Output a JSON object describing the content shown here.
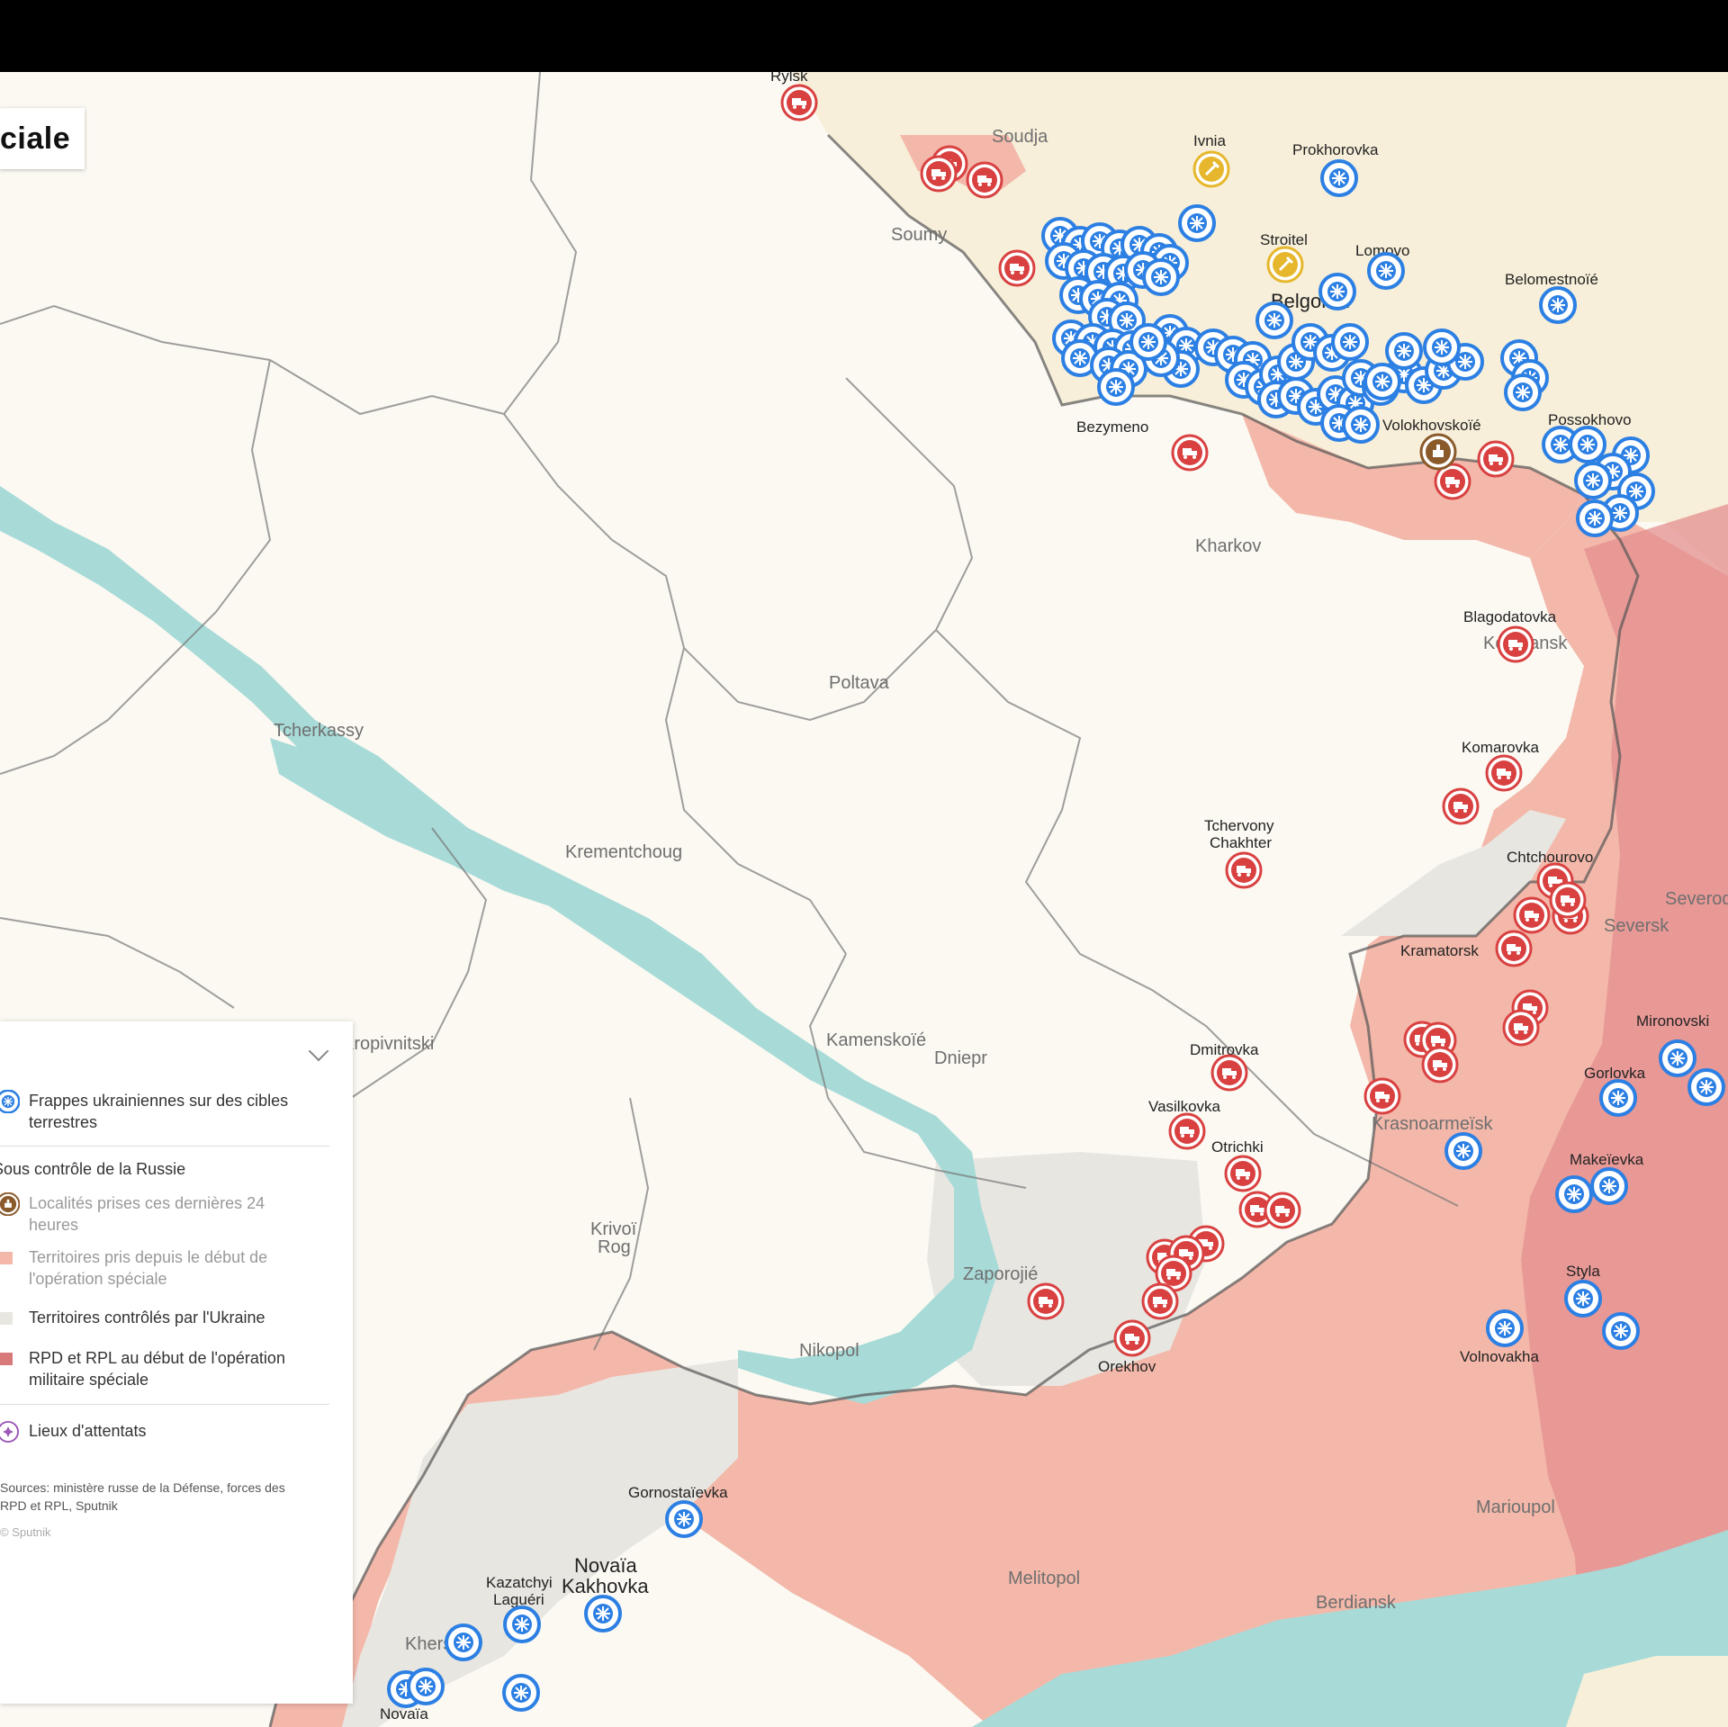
{
  "title": "ciale",
  "map": {
    "cities_major": [
      {
        "id": "soumy",
        "name": "Soumy"
      },
      {
        "id": "kharkov",
        "name": "Kharkov"
      },
      {
        "id": "poltava",
        "name": "Poltava"
      },
      {
        "id": "tcherkassy",
        "name": "Tcherkassy"
      },
      {
        "id": "krementchoug",
        "name": "Krementchoug"
      },
      {
        "id": "kamenskoie",
        "name": "Kamenskoïé"
      },
      {
        "id": "dniepr",
        "name": "Dniepr"
      },
      {
        "id": "krivoi",
        "name": "Krivoï"
      },
      {
        "id": "rog",
        "name": "Rog"
      },
      {
        "id": "zaporojie",
        "name": "Zaporojié"
      },
      {
        "id": "nikopol",
        "name": "Nikopol"
      },
      {
        "id": "melitopol",
        "name": "Melitopol"
      },
      {
        "id": "berdiansk",
        "name": "Berdiansk"
      },
      {
        "id": "marioupol",
        "name": "Marioupol"
      },
      {
        "id": "krasnoarmeisk",
        "name": "Krasnoarmeïsk"
      },
      {
        "id": "seversk",
        "name": "Seversk"
      },
      {
        "id": "soudja",
        "name": "Soudja"
      },
      {
        "id": "kherson",
        "name": "Kherson"
      },
      {
        "id": "kirovograd",
        "name": "Kropivnitski"
      },
      {
        "id": "koupiansk",
        "name": "Koupiansk"
      },
      {
        "id": "severodonetsk",
        "name": "Severodonetsk"
      }
    ],
    "towns": [
      {
        "id": "rylsk",
        "name": "Rylsk"
      },
      {
        "id": "ivnia",
        "name": "Ivnia"
      },
      {
        "id": "prokhorovka",
        "name": "Prokhorovka"
      },
      {
        "id": "stroitel",
        "name": "Stroitel"
      },
      {
        "id": "lomovo",
        "name": "Lomovo"
      },
      {
        "id": "belomestnoie",
        "name": "Belomestnoïé"
      },
      {
        "id": "belgorod",
        "name": "Belgorod"
      },
      {
        "id": "bezymeno",
        "name": "Bezymeno"
      },
      {
        "id": "volokhovskoie",
        "name": "Volokhovskoïé"
      },
      {
        "id": "possokhovo",
        "name": "Possokhovo"
      },
      {
        "id": "blagodatovka",
        "name": "Blagodatovka"
      },
      {
        "id": "komarovka",
        "name": "Komarovka"
      },
      {
        "id": "tchervony1",
        "name": "Tchervony"
      },
      {
        "id": "tchervony2",
        "name": "Chakhter"
      },
      {
        "id": "tchtchourovo",
        "name": "Chtchourovo"
      },
      {
        "id": "kramatorsk",
        "name": "Kramatorsk"
      },
      {
        "id": "mironovski",
        "name": "Mironovski"
      },
      {
        "id": "gorlovka",
        "name": "Gorlovka"
      },
      {
        "id": "dmitrovka",
        "name": "Dmitrovka"
      },
      {
        "id": "vasilkovka",
        "name": "Vasilkovka"
      },
      {
        "id": "otrichki",
        "name": "Otrichki"
      },
      {
        "id": "makeievka",
        "name": "Makeïevka"
      },
      {
        "id": "styla",
        "name": "Styla"
      },
      {
        "id": "volnovakha",
        "name": "Volnovakha"
      },
      {
        "id": "orekhov",
        "name": "Orekhov"
      },
      {
        "id": "gornostaievka",
        "name": "Gornostaïevka"
      },
      {
        "id": "kazatchyi1",
        "name": "Kazatchyi"
      },
      {
        "id": "kazatchyi2",
        "name": "Laguéri"
      },
      {
        "id": "novaia_k",
        "name": "Novaïa"
      },
      {
        "id": "kakhovka",
        "name": "Kakhovka"
      },
      {
        "id": "novaia",
        "name": "Novaïa"
      }
    ]
  },
  "legend": {
    "strikes": "Frappes ukrainiennes sur des cibles terrestres",
    "section_title": "Sous contrôle de la Russie",
    "localities": "Localités prises ces dernières 24 heures",
    "territories_taken": "Territoires pris depuis le début de l'opération spéciale",
    "territories_ukraine": "Territoires contrôlés par l'Ukraine",
    "rpd_rpl": "RPD et RPL au début de l'opération militaire spéciale",
    "attacks": "Lieux d'attentats",
    "sources": "Sources: ministère russe de la Défense, forces des RPD et RPL, Sputnik",
    "copyright": "© Sputnik"
  },
  "colors": {
    "background": "#fbf9f2",
    "russia_area": "#f7efd9",
    "occupied": "#f3b8aa",
    "ukraine_control": "#e8e6e1",
    "rpd_rpl": "#e48f8f",
    "water": "#a8dbd8",
    "strike_blue": "#2c7fe3",
    "armor_red": "#d94141",
    "gold": "#e6b72c",
    "attack_purple": "#9b59b6"
  }
}
